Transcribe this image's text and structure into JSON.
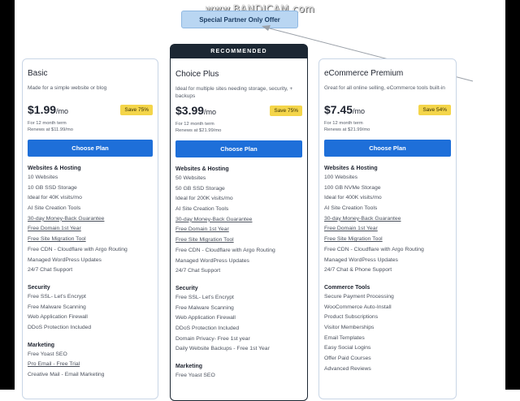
{
  "watermark": "www.BANDICAM.com",
  "callout": "Special Partner Only Offer",
  "plans": [
    {
      "badge": "",
      "name": "Basic",
      "desc": "Made for a simple website or blog",
      "price": "$1.99",
      "per": "/mo",
      "save": "Save 75%",
      "term": "For 12 month term",
      "renews": "Renews at $11.99/mo",
      "button": "Choose Plan",
      "sections": [
        {
          "title": "Websites & Hosting",
          "items": [
            {
              "text": "10 Websites"
            },
            {
              "text": "10 GB SSD Storage"
            },
            {
              "text": "Ideal for 40K visits/mo"
            },
            {
              "text": "AI Site Creation Tools"
            },
            {
              "text": "30-day Money-Back Guarantee",
              "u": true
            },
            {
              "text": "Free Domain 1st Year",
              "u": true
            },
            {
              "text": "Free Site Migration Tool",
              "u": true
            },
            {
              "text": "Free CDN - Cloudflare with Argo Routing"
            },
            {
              "text": "Managed WordPress Updates"
            },
            {
              "text": "24/7 Chat Support"
            }
          ]
        },
        {
          "title": "Security",
          "items": [
            {
              "text": "Free SSL- Let's Encrypt"
            },
            {
              "text": "Free Malware Scanning"
            },
            {
              "text": "Web Application Firewall"
            },
            {
              "text": "DDoS Protection Included"
            }
          ]
        },
        {
          "title": "Marketing",
          "items": [
            {
              "text": "Free Yoast SEO"
            },
            {
              "text": "Pro Email - Free Trial",
              "u": true
            },
            {
              "text": "Creative Mail - Email Marketing"
            }
          ]
        }
      ]
    },
    {
      "badge": "RECOMMENDED",
      "name": "Choice Plus",
      "desc": "Ideal for multiple sites needing storage, security, + backups",
      "price": "$3.99",
      "per": "/mo",
      "save": "Save 75%",
      "term": "For 12 month term",
      "renews": "Renews at $21.99/mo",
      "button": "Choose Plan",
      "sections": [
        {
          "title": "Websites & Hosting",
          "items": [
            {
              "text": "50 Websites"
            },
            {
              "text": "50 GB SSD Storage"
            },
            {
              "text": "Ideal for 200K visits/mo"
            },
            {
              "text": "AI Site Creation Tools"
            },
            {
              "text": "30-day Money-Back Guarantee",
              "u": true
            },
            {
              "text": "Free Domain 1st Year",
              "u": true
            },
            {
              "text": "Free Site Migration Tool",
              "u": true
            },
            {
              "text": "Free CDN - Cloudflare with Argo Routing"
            },
            {
              "text": "Managed WordPress Updates"
            },
            {
              "text": "24/7 Chat Support"
            }
          ]
        },
        {
          "title": "Security",
          "items": [
            {
              "text": "Free SSL- Let's Encrypt"
            },
            {
              "text": "Free Malware Scanning"
            },
            {
              "text": "Web Application Firewall"
            },
            {
              "text": "DDoS Protection Included"
            },
            {
              "text": "Domain Privacy- Free 1st year"
            },
            {
              "text": "Daily Website Backups - Free 1st Year"
            }
          ]
        },
        {
          "title": "Marketing",
          "items": [
            {
              "text": "Free Yoast SEO"
            }
          ]
        }
      ]
    },
    {
      "badge": "",
      "name": "eCommerce Premium",
      "desc": "Great for all online selling, eCommerce tools built-in",
      "price": "$7.45",
      "per": "/mo",
      "save": "Save 54%",
      "term": "For 12 month term",
      "renews": "Renews at $21.99/mo",
      "button": "Choose Plan",
      "sections": [
        {
          "title": "Websites & Hosting",
          "items": [
            {
              "text": "100 Websites"
            },
            {
              "text": "100 GB NVMe Storage"
            },
            {
              "text": "Ideal for 400K visits/mo"
            },
            {
              "text": "AI Site Creation Tools"
            },
            {
              "text": "30-day Money-Back Guarantee",
              "u": true
            },
            {
              "text": "Free Domain 1st Year",
              "u": true
            },
            {
              "text": "Free Site Migration Tool",
              "u": true
            },
            {
              "text": "Free CDN - Cloudflare with Argo Routing"
            },
            {
              "text": "Managed WordPress Updates"
            },
            {
              "text": "24/7 Chat & Phone Support"
            }
          ]
        },
        {
          "title": "Commerce Tools",
          "items": [
            {
              "text": "Secure Payment Processing"
            },
            {
              "text": "WooCommerce Auto-Install"
            },
            {
              "text": "Product Subscriptions"
            },
            {
              "text": "Visitor Memberships"
            },
            {
              "text": "Email Templates"
            },
            {
              "text": "Easy Social Logins"
            },
            {
              "text": "Offer Paid Courses"
            },
            {
              "text": "Advanced Reviews"
            }
          ]
        }
      ]
    }
  ]
}
